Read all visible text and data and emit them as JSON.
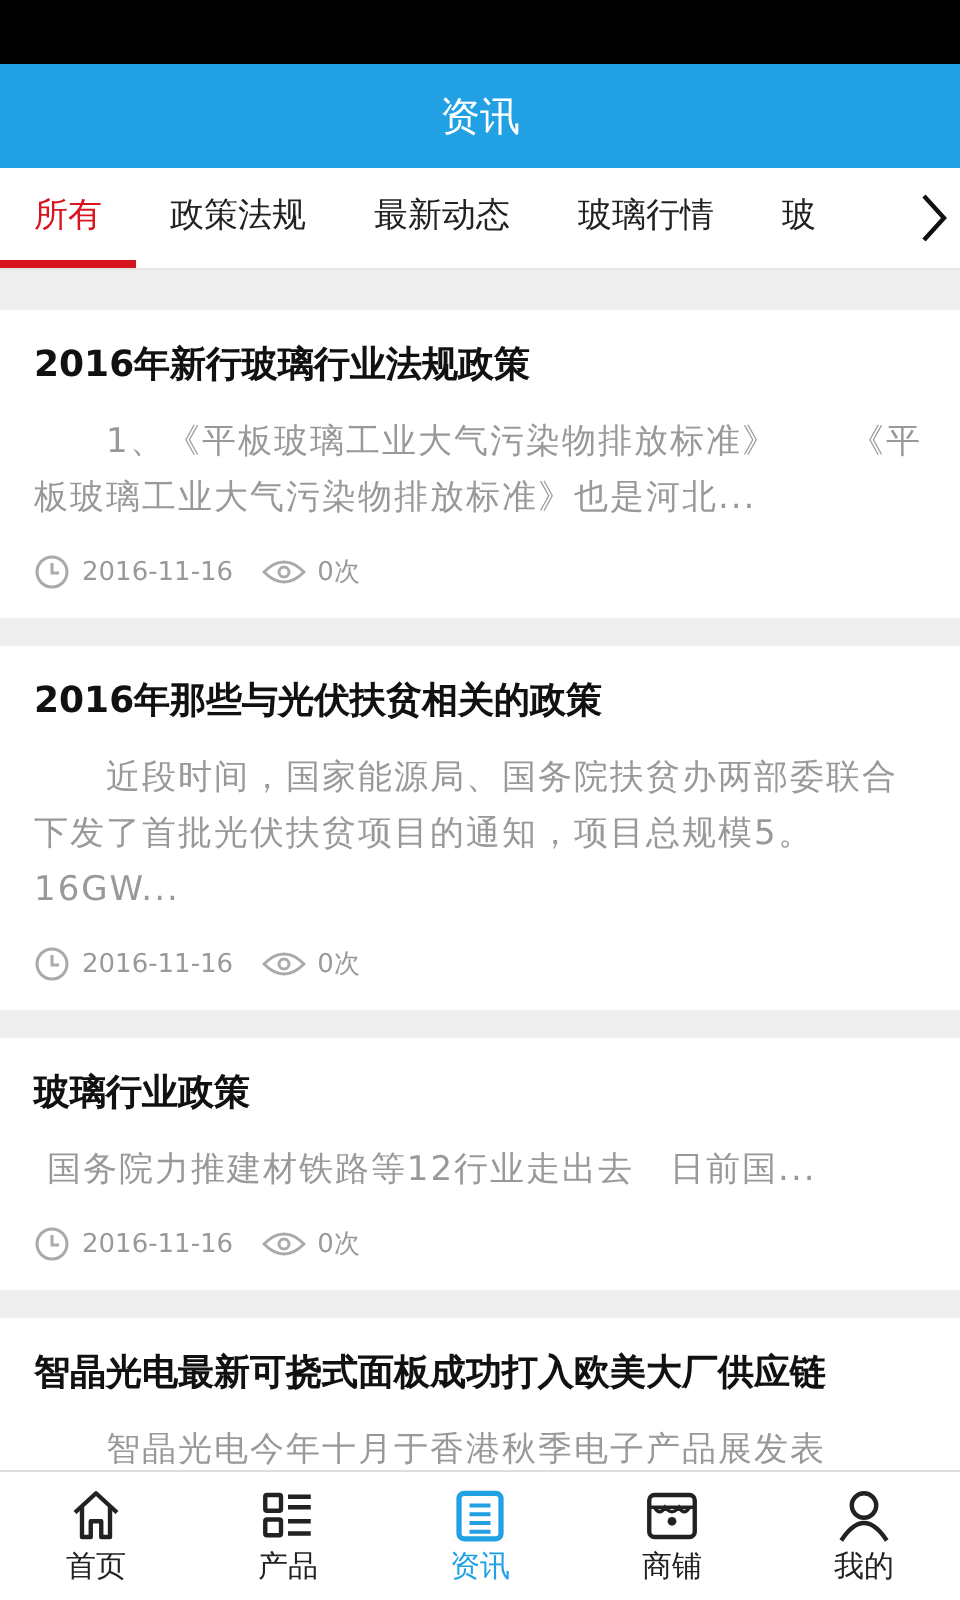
{
  "header": {
    "title": "资讯"
  },
  "tabs": [
    {
      "label": "所有",
      "selected": true
    },
    {
      "label": "政策法规",
      "selected": false
    },
    {
      "label": "最新动态",
      "selected": false
    },
    {
      "label": "玻璃行情",
      "selected": false
    },
    {
      "label": "玻",
      "selected": false
    }
  ],
  "articles": [
    {
      "title": "2016年新行玻璃行业法规政策",
      "summary": "　　1、《平板玻璃工业大气污染物排放标准》　　《平板玻璃工业大气污染物排放标准》也是河北...",
      "date": "2016-11-16",
      "views": "0次"
    },
    {
      "title": "2016年那些与光伏扶贫相关的政策",
      "summary": "　　近段时间，国家能源局、国务院扶贫办两部委联合下发了首批光伏扶贫项目的通知，项目总规模5。16GW...",
      "date": "2016-11-16",
      "views": "0次"
    },
    {
      "title": "玻璃行业政策",
      "summary": " 国务院力推建材铁路等12行业走出去　日前国...",
      "date": "2016-11-16",
      "views": "0次"
    },
    {
      "title": "智晶光电最新可挠式面板成功打入欧美大厂供应链",
      "summary": "　　智晶光电今年十月于香港秋季电子产品展发表"
    }
  ],
  "nav": [
    {
      "kind": "home",
      "label": "首页",
      "selected": false
    },
    {
      "kind": "list",
      "label": "产品",
      "selected": false
    },
    {
      "kind": "news",
      "label": "资讯",
      "selected": true
    },
    {
      "kind": "shop",
      "label": "商铺",
      "selected": false
    },
    {
      "kind": "user",
      "label": "我的",
      "selected": false
    }
  ]
}
